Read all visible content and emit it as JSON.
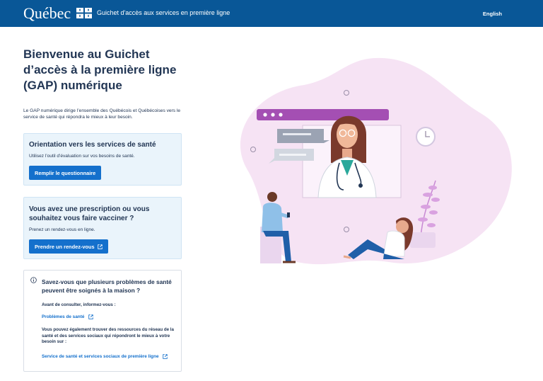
{
  "header": {
    "logo": "Québec",
    "title": "Guichet d'accès aux services en première ligne",
    "lang_link": "English"
  },
  "main": {
    "title": "Bienvenue au Guichet d’accès à la première ligne (GAP) numérique",
    "intro": "Le GAP numérique dirige l’ensemble des Québécois et Québécoises vers le service de santé qui répondra le mieux à leur besoin."
  },
  "cards": [
    {
      "title": "Orientation vers les services de santé",
      "text": "Utilisez l’outil d’évaluation sur vos besoins de santé.",
      "button": "Remplir le questionnaire"
    },
    {
      "title": "Vous avez une prescription ou vous souhaitez vous faire vacciner ?",
      "text": "Prenez un rendez-vous en ligne.",
      "button": "Prendre un rendez-vous"
    }
  ],
  "info": {
    "title": "Savez-vous que plusieurs problèmes de santé peuvent être soignés à la maison ?",
    "before_text": "Avant de consulter, informez-vous :",
    "link1": "Problèmes de santé",
    "resources_text": "Vous pouvez également trouver des ressources du réseau de la santé et des services sociaux qui répondront le mieux à votre besoin sur :",
    "link2": "Service de santé et services sociaux de première ligne"
  },
  "colors": {
    "header_bg": "#095797",
    "button_bg": "#1470cc",
    "card_bg": "#eaf4fb",
    "illustration_blob": "#f6e3f4"
  },
  "icons": [
    "quebec-flag-icon",
    "external-link-icon",
    "info-icon"
  ]
}
